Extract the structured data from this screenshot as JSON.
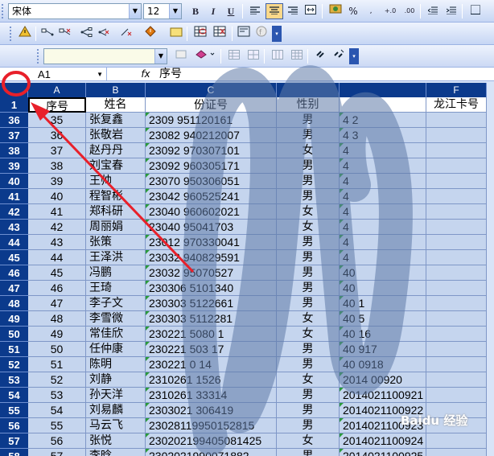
{
  "toolbar1": {
    "font_name": "宋体",
    "font_size": "12",
    "bold": "B",
    "italic": "I",
    "underline": "U",
    "percent": "%"
  },
  "toolbar3": {
    "style_box": ""
  },
  "formula_bar": {
    "cell_ref": "A1",
    "fx": "fx",
    "value": "序号"
  },
  "columns": [
    "A",
    "B",
    "C",
    "",
    "",
    "F"
  ],
  "header_row": {
    "row": "1",
    "A": "序号",
    "B": "姓名",
    "C": "份证号",
    "D": "性别",
    "E": "",
    "F": "龙江卡号"
  },
  "rows": [
    {
      "row": "36",
      "A": "35",
      "B": "张复鑫",
      "C": "2309   951120161",
      "D": "男",
      "E": "4       2",
      "F": ""
    },
    {
      "row": "37",
      "A": "36",
      "B": "张敬岩",
      "C": "23082  940212007",
      "D": "男",
      "E": "4       3",
      "F": ""
    },
    {
      "row": "38",
      "A": "37",
      "B": "赵丹丹",
      "C": "23092  970307101",
      "D": "女",
      "E": "4",
      "F": ""
    },
    {
      "row": "39",
      "A": "38",
      "B": "刘宝春",
      "C": "23092  960305171",
      "D": "男",
      "E": "4",
      "F": ""
    },
    {
      "row": "40",
      "A": "39",
      "B": "王帅",
      "C": "23070  950306051",
      "D": "男",
      "E": "4",
      "F": ""
    },
    {
      "row": "41",
      "A": "40",
      "B": "程智彬",
      "C": "23042  960525241",
      "D": "男",
      "E": "4",
      "F": ""
    },
    {
      "row": "42",
      "A": "41",
      "B": "郑科研",
      "C": "23040  960602021",
      "D": "女",
      "E": "4",
      "F": ""
    },
    {
      "row": "43",
      "A": "42",
      "B": "周丽娟",
      "C": "23040  95041703",
      "D": "女",
      "E": "4",
      "F": ""
    },
    {
      "row": "44",
      "A": "43",
      "B": "张策",
      "C": "23012  970330041",
      "D": "男",
      "E": "4",
      "F": ""
    },
    {
      "row": "45",
      "A": "44",
      "B": "王泽洪",
      "C": "23032  940829591",
      "D": "男",
      "E": "4",
      "F": ""
    },
    {
      "row": "46",
      "A": "45",
      "B": "冯鹏",
      "C": "23032  95070527",
      "D": "男",
      "E": "40",
      "F": ""
    },
    {
      "row": "47",
      "A": "46",
      "B": "王琦",
      "C": "230306  5101340",
      "D": "男",
      "E": "40",
      "F": ""
    },
    {
      "row": "48",
      "A": "47",
      "B": "李子文",
      "C": "230303  5122661",
      "D": "男",
      "E": "40      1",
      "F": ""
    },
    {
      "row": "49",
      "A": "48",
      "B": "李雪微",
      "C": "230303  5112281",
      "D": "女",
      "E": "40      5",
      "F": ""
    },
    {
      "row": "50",
      "A": "49",
      "B": "常佳欣",
      "C": "230221  5080   1",
      "D": "女",
      "E": "40      16",
      "F": ""
    },
    {
      "row": "51",
      "A": "50",
      "B": "任仲康",
      "C": "230221  503    17",
      "D": "男",
      "E": "40     917",
      "F": ""
    },
    {
      "row": "52",
      "A": "51",
      "B": "陈明",
      "C": "230221   0   14",
      "D": "男",
      "E": "40     0918",
      "F": ""
    },
    {
      "row": "53",
      "A": "52",
      "B": "刘静",
      "C": "2310261      1526",
      "D": "女",
      "E": "2014  00920",
      "F": ""
    },
    {
      "row": "54",
      "A": "53",
      "B": "孙天洋",
      "C": "2310261      33314",
      "D": "男",
      "E": "2014021100921",
      "F": ""
    },
    {
      "row": "55",
      "A": "54",
      "B": "刘易麟",
      "C": "2303021  306419",
      "D": "男",
      "E": "2014021100922",
      "F": ""
    },
    {
      "row": "56",
      "A": "55",
      "B": "马云飞",
      "C": "23028119950152815",
      "D": "男",
      "E": "2014021100923",
      "F": ""
    },
    {
      "row": "57",
      "A": "56",
      "B": "张悦",
      "C": "230202199405081425",
      "D": "女",
      "E": "2014021100924",
      "F": ""
    },
    {
      "row": "58",
      "A": "57",
      "B": "李晗",
      "C": "2302021990071882",
      "D": "男",
      "E": "2014021100925",
      "F": ""
    }
  ],
  "watermark": "Baidu 经验",
  "colors": {
    "header_blue": "#0b3a8c",
    "cell_fill": "#c5d5ee",
    "annotation_red": "#e8202a",
    "scribble": "#5f7aa8"
  }
}
